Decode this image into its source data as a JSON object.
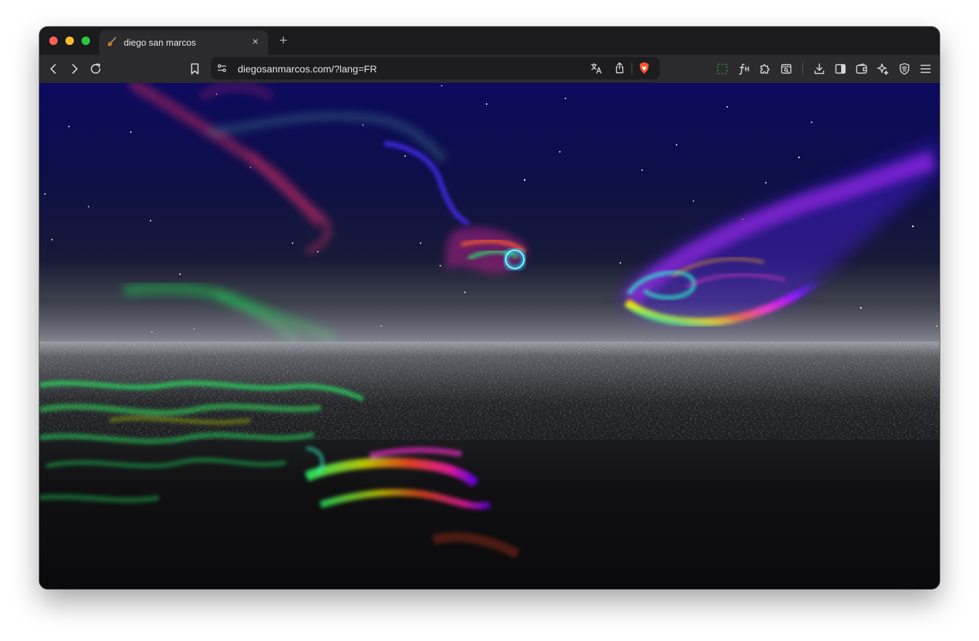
{
  "tab": {
    "title": "diego san marcos",
    "close_glyph": "×",
    "favicon": "guitar-icon"
  },
  "new_tab_glyph": "+",
  "omnibox": {
    "url": "diegosanmarcos.com/?lang=FR"
  },
  "toolbar_icons": [
    "back-icon",
    "forward-icon",
    "reload-icon",
    "bookmark-icon",
    "site-settings-icon",
    "translate-icon",
    "share-icon",
    "brave-shields-icon",
    "screenshot-icon",
    "font-icon",
    "extensions-icon",
    "reader-icon",
    "downloads-icon",
    "sidebar-icon",
    "wallet-icon",
    "leo-ai-icon",
    "vpn-icon",
    "menu-icon"
  ],
  "colors": {
    "traffic_close": "#fe5f57",
    "traffic_minimize": "#febc2e",
    "traffic_maximize": "#28c840",
    "brave_orange": "#fb542b",
    "sky_top": "#0d0a5a",
    "water": "#0b0b0d"
  }
}
